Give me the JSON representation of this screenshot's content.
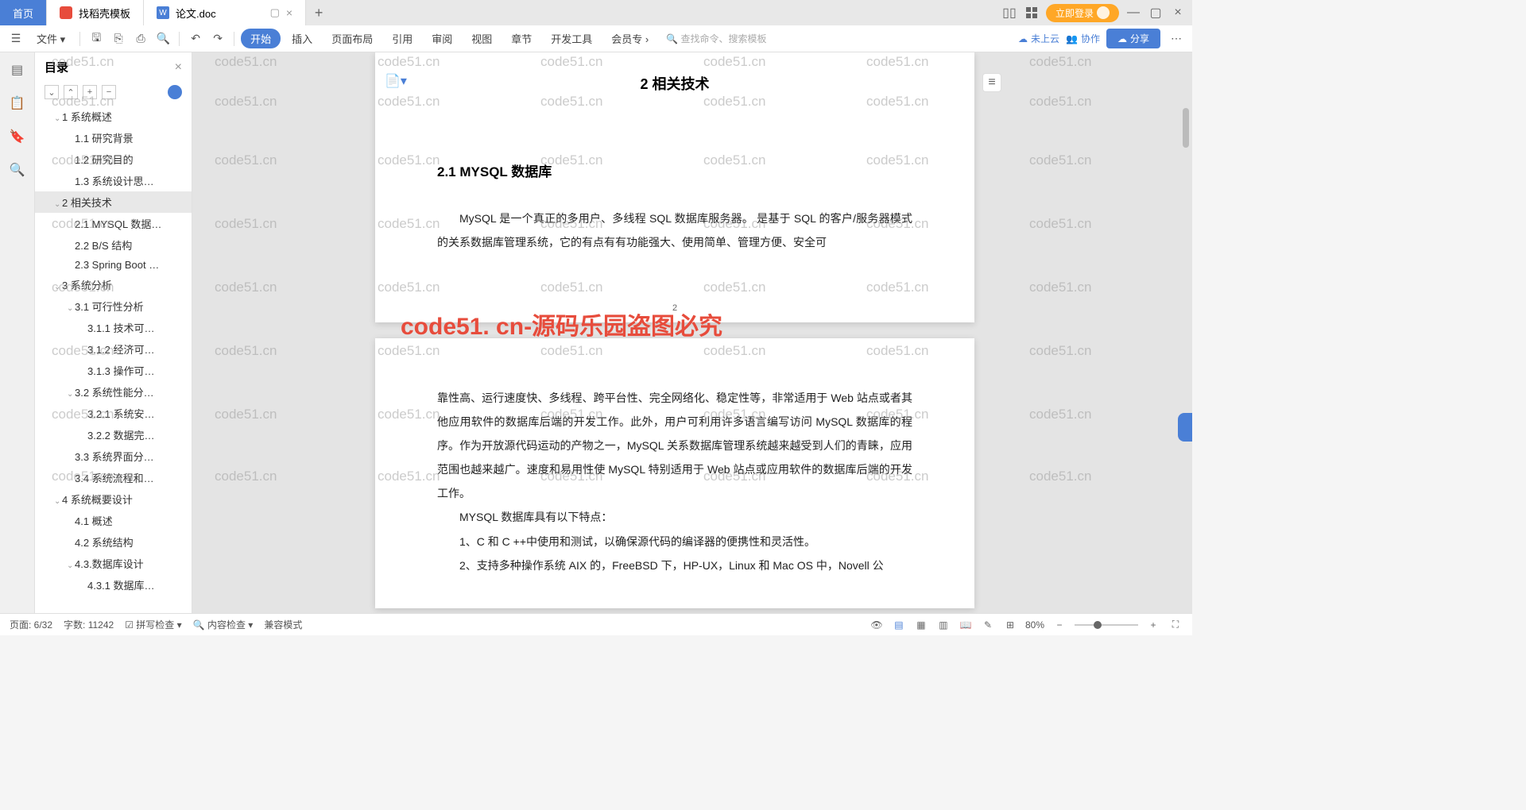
{
  "tabs": {
    "home": "首页",
    "template": "找稻壳模板",
    "doc": "论文.doc"
  },
  "login": "立即登录",
  "ribbon": {
    "file": "文件",
    "menus": [
      "开始",
      "插入",
      "页面布局",
      "引用",
      "审阅",
      "视图",
      "章节",
      "开发工具",
      "会员专"
    ],
    "search": "查找命令、搜索模板",
    "cloud": "未上云",
    "coop": "协作",
    "share": "分享"
  },
  "outline": {
    "title": "目录",
    "items": [
      {
        "t": "1 系统概述",
        "lvl": 1,
        "c": true
      },
      {
        "t": "1.1 研究背景",
        "lvl": 2
      },
      {
        "t": "1.2 研究目的",
        "lvl": 2
      },
      {
        "t": "1.3 系统设计思…",
        "lvl": 2
      },
      {
        "t": "2 相关技术",
        "lvl": 1,
        "c": true,
        "sel": true
      },
      {
        "t": "2.1 MYSQL 数据…",
        "lvl": 2
      },
      {
        "t": "2.2 B/S 结构",
        "lvl": 2
      },
      {
        "t": "2.3 Spring Boot …",
        "lvl": 2
      },
      {
        "t": "3 系统分析",
        "lvl": 1,
        "c": true
      },
      {
        "t": "3.1 可行性分析",
        "lvl": 2,
        "c": true
      },
      {
        "t": "3.1.1 技术可…",
        "lvl": 3
      },
      {
        "t": "3.1.2 经济可…",
        "lvl": 3
      },
      {
        "t": "3.1.3 操作可…",
        "lvl": 3
      },
      {
        "t": "3.2 系统性能分…",
        "lvl": 2,
        "c": true
      },
      {
        "t": "3.2.1  系统安…",
        "lvl": 3
      },
      {
        "t": "3.2.2 数据完…",
        "lvl": 3
      },
      {
        "t": "3.3 系统界面分…",
        "lvl": 2
      },
      {
        "t": "3.4 系统流程和…",
        "lvl": 2
      },
      {
        "t": "4 系统概要设计",
        "lvl": 1,
        "c": true
      },
      {
        "t": "4.1 概述",
        "lvl": 2
      },
      {
        "t": "4.2 系统结构",
        "lvl": 2
      },
      {
        "t": "4.3.数据库设计",
        "lvl": 2,
        "c": true
      },
      {
        "t": "4.3.1 数据库…",
        "lvl": 3
      }
    ]
  },
  "doc": {
    "heading": "2 相关技术",
    "subheading": "2.1 MYSQL 数据库",
    "p1": "MySQL 是一个真正的多用户、多线程 SQL 数据库服务器。 是基于 SQL 的客户/服务器模式的关系数据库管理系统，它的有点有有功能强大、使用简单、管理方便、安全可",
    "pagenum": "2",
    "p2": "靠性高、运行速度快、多线程、跨平台性、完全网络化、稳定性等，非常适用于 Web 站点或者其他应用软件的数据库后端的开发工作。此外，用户可利用许多语言编写访问 MySQL 数据库的程序。作为开放源代码运动的产物之一，MySQL 关系数据库管理系统越来越受到人们的青睐，应用范围也越来越广。速度和易用性使 MySQL 特别适用于 Web 站点或应用软件的数据库后端的开发工作。",
    "p3": "MYSQL 数据库具有以下特点：",
    "p4": "1、C 和 C ++中使用和测试，以确保源代码的编译器的便携性和灵活性。",
    "p5": "2、支持多种操作系统 AIX 的，FreeBSD 下，HP-UX，Linux 和 Mac OS 中，Novell 公"
  },
  "watermark": "code51.cn",
  "bigwatermark": "code51. cn-源码乐园盗图必究",
  "status": {
    "page": "页面: 6/32",
    "words": "字数: 11242",
    "spell": "拼写检查",
    "content": "内容检查",
    "compat": "兼容模式",
    "zoom": "80%"
  }
}
